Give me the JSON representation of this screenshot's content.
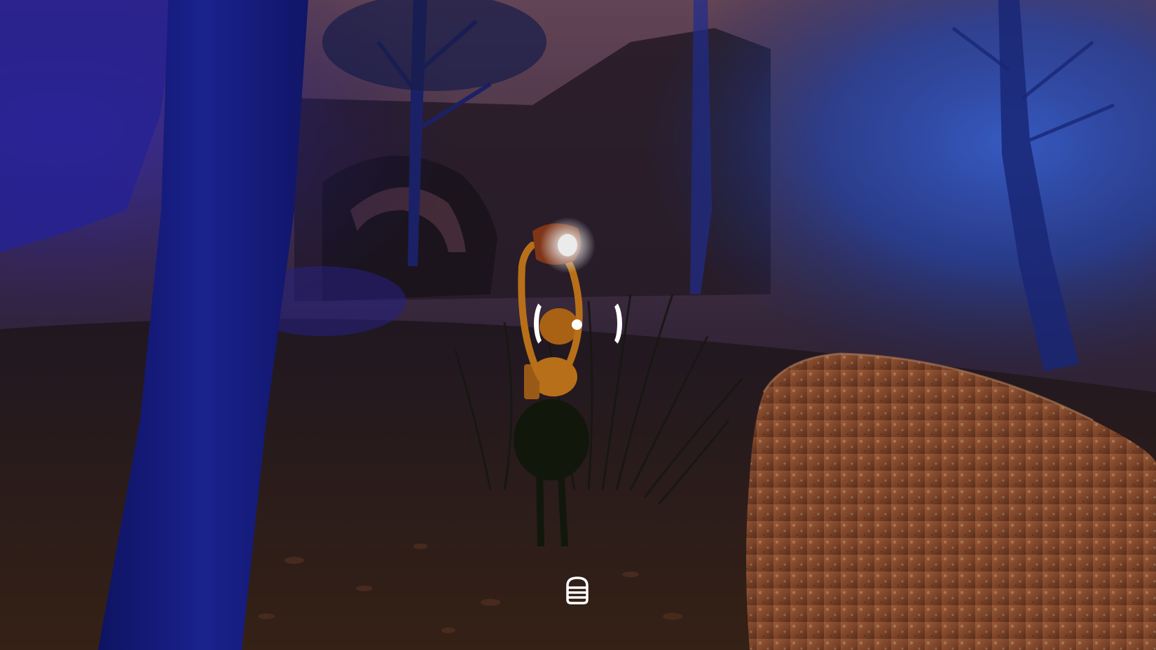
{
  "scene": {
    "description_icon": "forest-night-scene",
    "colors": {
      "sky": "#5a3a4e",
      "fog": "#2c52c4",
      "tree_trunk": "#19208a",
      "ground": "#2a1d17",
      "boulder": "#9b5a3a",
      "ant_body": "#c77a1c",
      "ant_abdomen": "#141a0c",
      "light_glow": "#ffffff"
    }
  },
  "hud": {
    "reticle_icon": "crosshair-reticle-icon",
    "inventory_icon": "backpack-icon",
    "accent_color": "#ffffff"
  }
}
